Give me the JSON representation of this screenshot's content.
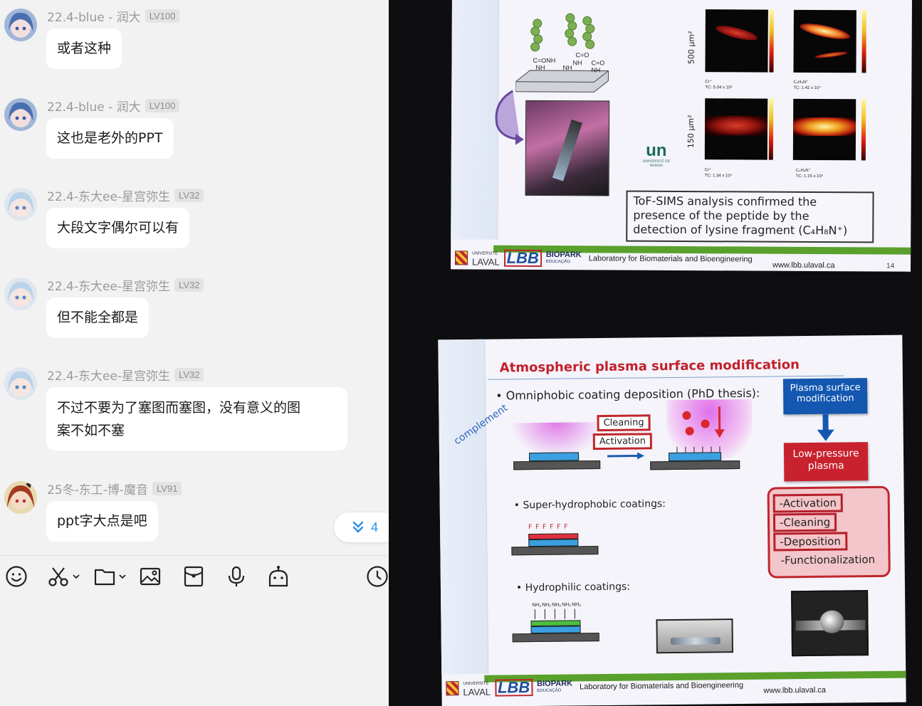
{
  "messages": [
    {
      "nickname": "22.4-blue - 润大",
      "level": "LV100",
      "text": "或者这种",
      "avatar": "blue-hair-anime-avatar"
    },
    {
      "nickname": "22.4-blue - 润大",
      "level": "LV100",
      "text": "这也是老外的PPT",
      "avatar": "blue-hair-anime-avatar"
    },
    {
      "nickname": "22.4-东大ee-星宫弥生",
      "level": "LV32",
      "text": "大段文字偶尔可以有",
      "avatar": "silver-hair-anime-avatar"
    },
    {
      "nickname": "22.4-东大ee-星宫弥生",
      "level": "LV32",
      "text": "但不能全都是",
      "avatar": "silver-hair-anime-avatar"
    },
    {
      "nickname": "22.4-东大ee-星宫弥生",
      "level": "LV32",
      "text_line1": "不过不要为了塞图而塞图，没有意义的图",
      "text_line2": "案不如不塞",
      "avatar": "silver-hair-anime-avatar"
    },
    {
      "nickname": "25冬-东工-博-魔音",
      "level": "LV91",
      "text": "ppt字大点是吧",
      "avatar": "red-hair-anime-avatar"
    }
  ],
  "new_messages_badge": {
    "count": "4",
    "icon": "double-chevron-down-icon"
  },
  "toolbar": {
    "icons": [
      "emoji-icon",
      "scissors-icon",
      "folder-icon",
      "image-icon",
      "red-packet-icon",
      "microphone-icon",
      "robot-icon",
      "clock-icon"
    ]
  },
  "photo": {
    "slide_top": {
      "ylabel_1": "500 µm²",
      "ylabel_2": "150 µm²",
      "panel_labels": [
        {
          "ion": "Cr⁺",
          "tc": "TC: 5.04 x 10²"
        },
        {
          "ion": "C₄H₈N⁺",
          "tc": "TC: 1.42 x 10⁴"
        },
        {
          "ion": "Cr⁺",
          "tc": "TC: 1.34 x 10⁴"
        },
        {
          "ion": "C₄H₈N⁺",
          "tc": "TC: 1.15 x 10⁵"
        }
      ],
      "chem_labels": [
        "C=ONH",
        "NH",
        "NH",
        "C=O",
        "NH",
        "C=O",
        "NH"
      ],
      "namur_logo": "UNIVERSITÉ DE NAMUR",
      "conclusion_line1": "ToF-SIMS analysis confirmed the",
      "conclusion_line2": "presence of the peptide by the",
      "conclusion_line3": "detection of lysine fragment (C₄H₈N⁺)",
      "footer_lab": "Laboratory for Biomaterials and Bioengineering",
      "footer_url": "www.lbb.ulaval.ca",
      "page_number": "14"
    },
    "slide_bottom": {
      "title": "Atmospheric plasma surface modification",
      "bullet1": "• Omniphobic coating deposition (PhD thesis):",
      "complement": "complement",
      "cleaning": "Cleaning",
      "activation": "Activation",
      "bullet2": "• Super-hydrophobic coatings:",
      "f_labels": "F  F  F  F  F  F",
      "bullet3": "• Hydrophilic coatings:",
      "nh2": "NH₂",
      "plasma_surface_line1": "Plasma surface",
      "plasma_surface_line2": "modification",
      "low_pressure_line1": "Low-pressure",
      "low_pressure_line2": "plasma",
      "steps": [
        "-Activation",
        "-Cleaning",
        "-Deposition"
      ],
      "step4": "-Functionalization",
      "footer_lab": "Laboratory for Biomaterials and Bioengineering",
      "footer_url": "www.lbb.ulaval.ca"
    },
    "footer_logos": {
      "laval_top": "UNIVERSITÉ",
      "laval": "LAVAL",
      "lbb": "LBB",
      "biopark": "BIOPARK",
      "biopark_sub": "EDUCAÇÃO"
    }
  }
}
